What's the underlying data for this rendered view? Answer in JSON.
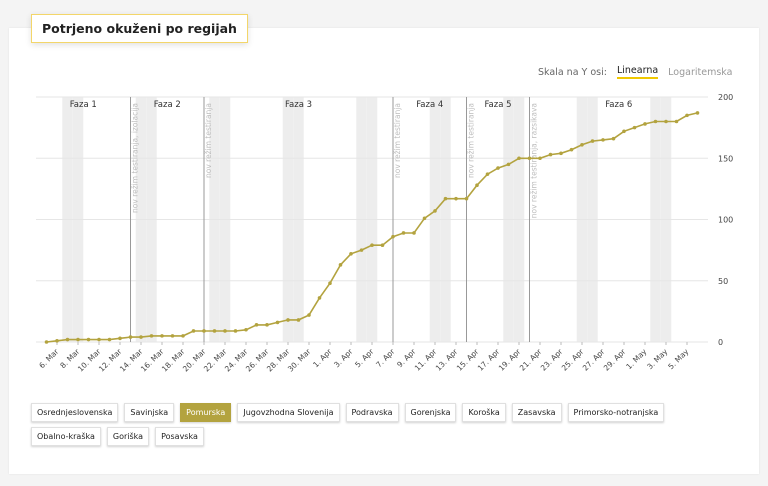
{
  "title": "Potrjeno okuženi po regijah",
  "scale": {
    "label": "Skala na Y osi:",
    "options": [
      {
        "label": "Linearna",
        "active": true
      },
      {
        "label": "Logaritemska",
        "active": false
      }
    ]
  },
  "regions": [
    {
      "label": "Osrednjeslovenska",
      "selected": false
    },
    {
      "label": "Savinjska",
      "selected": false
    },
    {
      "label": "Pomurska",
      "selected": true
    },
    {
      "label": "Jugovzhodna Slovenija",
      "selected": false
    },
    {
      "label": "Podravska",
      "selected": false
    },
    {
      "label": "Gorenjska",
      "selected": false
    },
    {
      "label": "Koroška",
      "selected": false
    },
    {
      "label": "Zasavska",
      "selected": false
    },
    {
      "label": "Primorsko-notranjska",
      "selected": false
    },
    {
      "label": "Obalno-kraška",
      "selected": false
    },
    {
      "label": "Goriška",
      "selected": false
    },
    {
      "label": "Posavska",
      "selected": false
    }
  ],
  "colors": {
    "line": "#b3a33f",
    "accent": "#f0c800",
    "weekend": "#ededed",
    "phase_line": "#999999"
  },
  "chart_data": {
    "type": "line",
    "series": [
      {
        "name": "Pomurska",
        "start_date": "2020-03-05",
        "values": [
          0,
          1,
          2,
          2,
          2,
          2,
          2,
          3,
          4,
          4,
          5,
          5,
          5,
          5,
          9,
          9,
          9,
          9,
          9,
          10,
          14,
          14,
          16,
          18,
          18,
          22,
          36,
          48,
          63,
          72,
          75,
          79,
          79,
          86,
          89,
          89,
          101,
          107,
          117,
          117,
          117,
          128,
          137,
          142,
          145,
          150,
          150,
          150,
          153,
          154,
          157,
          161,
          164,
          165,
          166,
          172,
          175,
          178,
          180,
          180,
          180,
          185,
          187
        ]
      }
    ],
    "x_tick_labels": [
      "6. Mar",
      "8. Mar",
      "10. Mar",
      "12. Mar",
      "14. Mar",
      "16. Mar",
      "18. Mar",
      "20. Mar",
      "22. Mar",
      "24. Mar",
      "26. Mar",
      "28. Mar",
      "30. Mar",
      "1. Apr",
      "3. Apr",
      "5. Apr",
      "7. Apr",
      "9. Apr",
      "11. Apr",
      "13. Apr",
      "15. Apr",
      "17. Apr",
      "19. Apr",
      "21. Apr",
      "23. Apr",
      "25. Apr",
      "27. Apr",
      "29. Apr",
      "1. May",
      "3. May",
      "5. May"
    ],
    "y_ticks": [
      0,
      50,
      100,
      150,
      200
    ],
    "ylim": [
      0,
      200
    ],
    "phases": [
      {
        "label": "Faza 1",
        "start": "2020-03-04",
        "end": "2020-03-13"
      },
      {
        "label": "Faza 2",
        "start": "2020-03-13",
        "end": "2020-03-20"
      },
      {
        "label": "Faza 3",
        "start": "2020-03-20",
        "end": "2020-04-07"
      },
      {
        "label": "Faza 4",
        "start": "2020-04-07",
        "end": "2020-04-14"
      },
      {
        "label": "Faza 5",
        "start": "2020-04-14",
        "end": "2020-04-20"
      },
      {
        "label": "Faza 6",
        "start": "2020-04-20",
        "end": "2020-05-07"
      }
    ],
    "annotations": [
      {
        "date": "2020-03-13",
        "text": "nov režim testiranja, izolacija"
      },
      {
        "date": "2020-03-20",
        "text": "nov režim testiranja"
      },
      {
        "date": "2020-04-07",
        "text": "nov režim testiranja"
      },
      {
        "date": "2020-04-14",
        "text": "nov režim testiranja"
      },
      {
        "date": "2020-04-20",
        "text": "nov režim testiranja, razsikava"
      }
    ],
    "weekends": [
      "2020-03-07",
      "2020-03-08",
      "2020-03-14",
      "2020-03-15",
      "2020-03-21",
      "2020-03-22",
      "2020-03-28",
      "2020-03-29",
      "2020-04-04",
      "2020-04-05",
      "2020-04-11",
      "2020-04-12",
      "2020-04-18",
      "2020-04-19",
      "2020-04-25",
      "2020-04-26",
      "2020-05-02",
      "2020-05-03"
    ]
  }
}
